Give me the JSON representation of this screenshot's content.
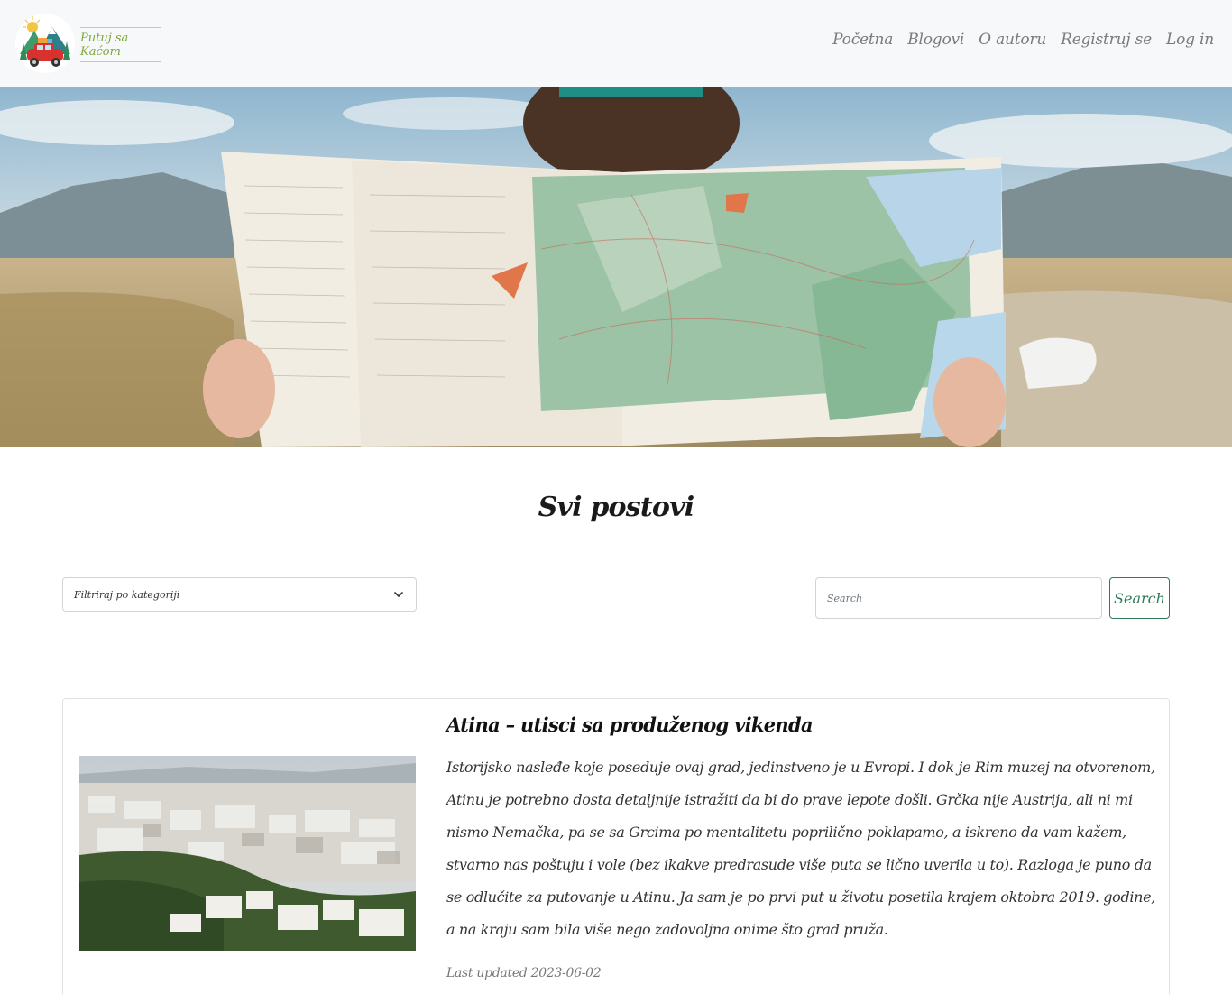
{
  "brand": {
    "name": "Putuj sa Kaćom"
  },
  "nav": {
    "items": [
      "Početna",
      "Blogovi",
      "O autoru",
      "Registruj se",
      "Log in"
    ]
  },
  "main": {
    "title": "Svi postovi",
    "filter": {
      "selected": "Filtriraj po kategoriji"
    },
    "search": {
      "placeholder": "Search",
      "button": "Search"
    }
  },
  "posts": [
    {
      "title": "Atina – utisci sa produženog vikenda",
      "excerpt": "Istorijsko nasleđe koje poseduje ovaj grad, jedinstveno je u Evropi. I dok je Rim muzej na otvorenom, Atinu je potrebno dosta detaljnije istražiti da bi do prave lepote došli. Grčka nije Austrija, ali ni mi nismo Nemačka, pa se sa Grcima po mentalitetu poprilično poklapamo, a iskreno da vam kažem, stvarno nas poštuju i vole (bez ikakve predrasude više puta se lično uverila u to). Razloga je puno da se odlučite za putovanje u Atinu. Ja sam je po prvi put u životu posetila krajem oktobra 2019. godine, a na kraju sam bila više nego zadovoljna onime što grad pruža.",
      "updated": "Last updated 2023-06-02"
    }
  ],
  "colors": {
    "accent_green": "#2f7a57",
    "brand_green": "#7aa832",
    "navbar_bg": "#f7f8f9"
  }
}
